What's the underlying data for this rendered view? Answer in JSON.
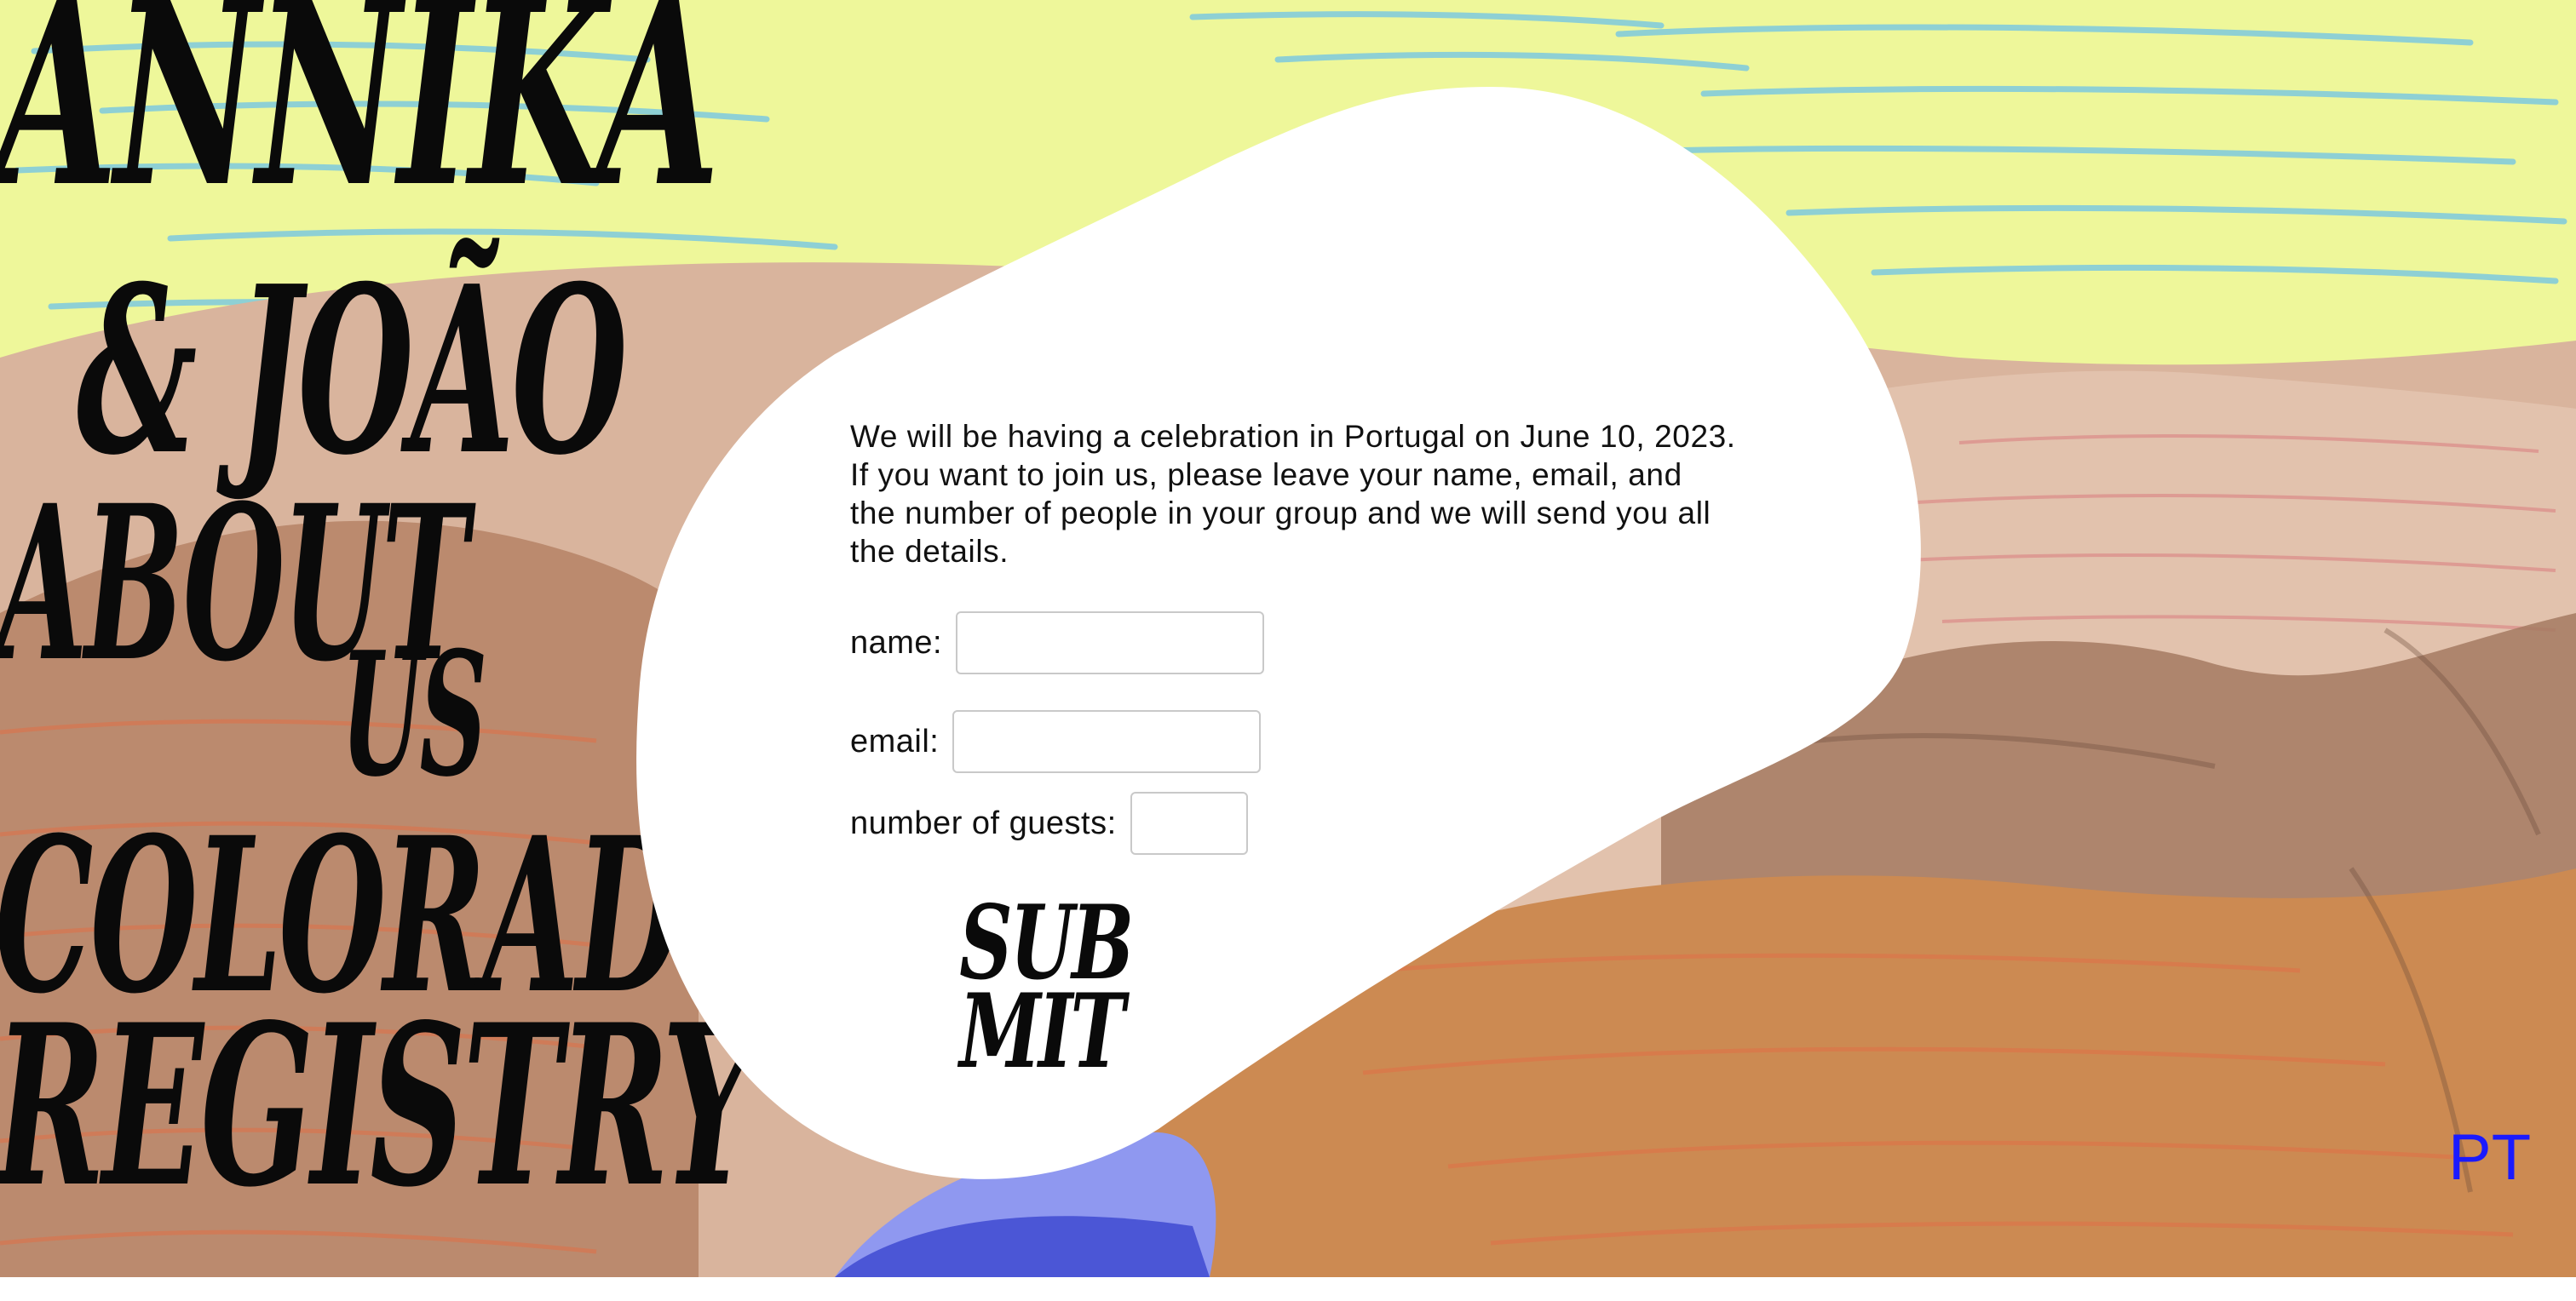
{
  "nav": {
    "names_line1": "ANNIKA",
    "names_line2": "& JOÃO",
    "about_line1": "ABOUT",
    "about_line2": "US",
    "colorado": "COLORADO",
    "registry": "REGISTRY"
  },
  "form": {
    "intro": "We will be having a celebration in Portugal on June 10, 2023. If you want to join us, please leave your name, email, and the number of people in your group and we will send you all the details.",
    "name_label": "name:",
    "name_value": "",
    "email_label": "email:",
    "email_value": "",
    "guests_label": "number of guests:",
    "guests_value": "",
    "submit_line1": "SUB",
    "submit_line2": "MIT"
  },
  "language_toggle": "PT",
  "colors": {
    "sky": "#eef79a",
    "sky_strokes": "#6ec3e8",
    "hills_light": "#d9b49d",
    "hills_mid": "#b58366",
    "hills_orange": "#cc8a52",
    "water": "#8f98f0",
    "text": "#0a0a0a",
    "link": "#1a1aff"
  }
}
